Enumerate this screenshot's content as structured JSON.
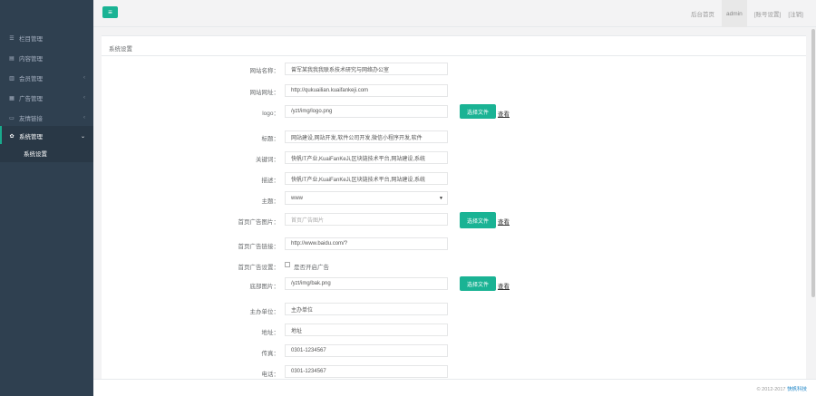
{
  "sidebar": {
    "items": [
      {
        "label": "栏目管理",
        "icon": "list-icon",
        "has_children": false
      },
      {
        "label": "内容管理",
        "icon": "table-icon",
        "has_children": false
      },
      {
        "label": "会员管理",
        "icon": "users-icon",
        "has_children": true
      },
      {
        "label": "广告管理",
        "icon": "picture-icon",
        "has_children": true
      },
      {
        "label": "友情链接",
        "icon": "link-icon",
        "has_children": true
      },
      {
        "label": "系统管理",
        "icon": "gear-icon",
        "has_children": true,
        "active": true
      }
    ],
    "sub_items": [
      {
        "label": "系统设置"
      }
    ]
  },
  "topbar": {
    "menu_icon": "hamburger-icon",
    "links": {
      "home": "后台首页",
      "admin": "admin",
      "account": "[账号设置]",
      "logout": "[注销]"
    }
  },
  "panel": {
    "title": "系统设置"
  },
  "form": {
    "site_name": {
      "label": "网站名称：",
      "value": "曾军某我我我联系技术研究与网络办公室"
    },
    "site_url": {
      "label": "网站网址：",
      "value": "http://qukuailian.kuaifankeji.com"
    },
    "logo": {
      "label": "logo：",
      "value": "/yzt/img/logo.png",
      "button": "选择文件",
      "view": "查看"
    },
    "title": {
      "label": "标题：",
      "value": "网站建设,网站开发,软件公司开发,微信小程序开发,软件"
    },
    "keywords": {
      "label": "关键词：",
      "value": "快帆IT产业,KuaiFanKeJi,区块链技术平台,网站建设,系统"
    },
    "description": {
      "label": "描述：",
      "value": "快帆IT产业,KuaiFanKeJi,区块链技术平台,网站建设,系统"
    },
    "theme": {
      "label": "主题：",
      "value": "www"
    },
    "home_ad_image": {
      "label": "首页广告图片：",
      "placeholder": "首页广告图片",
      "button": "选择文件",
      "view": "查看"
    },
    "home_ad_link": {
      "label": "首页广告链接：",
      "value": "http://www.baidu.com/?"
    },
    "home_ad_setting": {
      "label": "首页广告设置：",
      "checkbox_label": "是否开启广告",
      "checked": false
    },
    "footer_logo": {
      "label": "底部图片：",
      "value": "/yzt/img/bak.png",
      "button": "选择文件",
      "view": "查看"
    },
    "organizer": {
      "label": "主办单位：",
      "value": "主办单位"
    },
    "address": {
      "label": "地址：",
      "value": "地址"
    },
    "fax": {
      "label": "传真：",
      "value": "0301-1234567"
    },
    "phone": {
      "label": "电话：",
      "value": "0301-1234567"
    }
  },
  "footer": {
    "copyright": "© 2012-2017",
    "link": "快帆科技"
  },
  "colors": {
    "sidebar_bg": "#2f4050",
    "accent": "#1ab394",
    "panel_bg": "#ffffff"
  }
}
